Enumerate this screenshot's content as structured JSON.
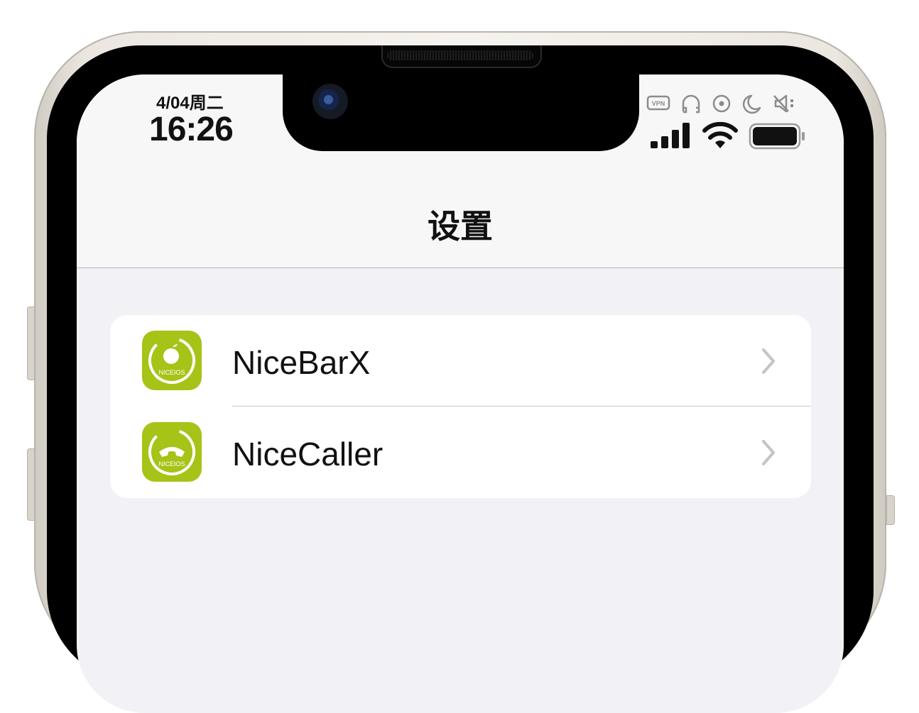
{
  "status_bar": {
    "date": "4/04周二",
    "time": "16:26",
    "indicator_icons": [
      "vpn-icon",
      "headphones-icon",
      "location-icon",
      "moon-icon",
      "mute-icon"
    ],
    "vpn_text": "VPN"
  },
  "navbar": {
    "title": "设置"
  },
  "settings_list": {
    "items": [
      {
        "label": "NiceBarX",
        "icon": "nicebarx-app-icon",
        "icon_text": "NICEIOS"
      },
      {
        "label": "NiceCaller",
        "icon": "nicecaller-app-icon",
        "icon_text": "NICEIOS"
      }
    ]
  },
  "colors": {
    "accent_green": "#a6c317",
    "chevron": "#c4c4c7",
    "grouped_bg": "#f2f1f6"
  }
}
